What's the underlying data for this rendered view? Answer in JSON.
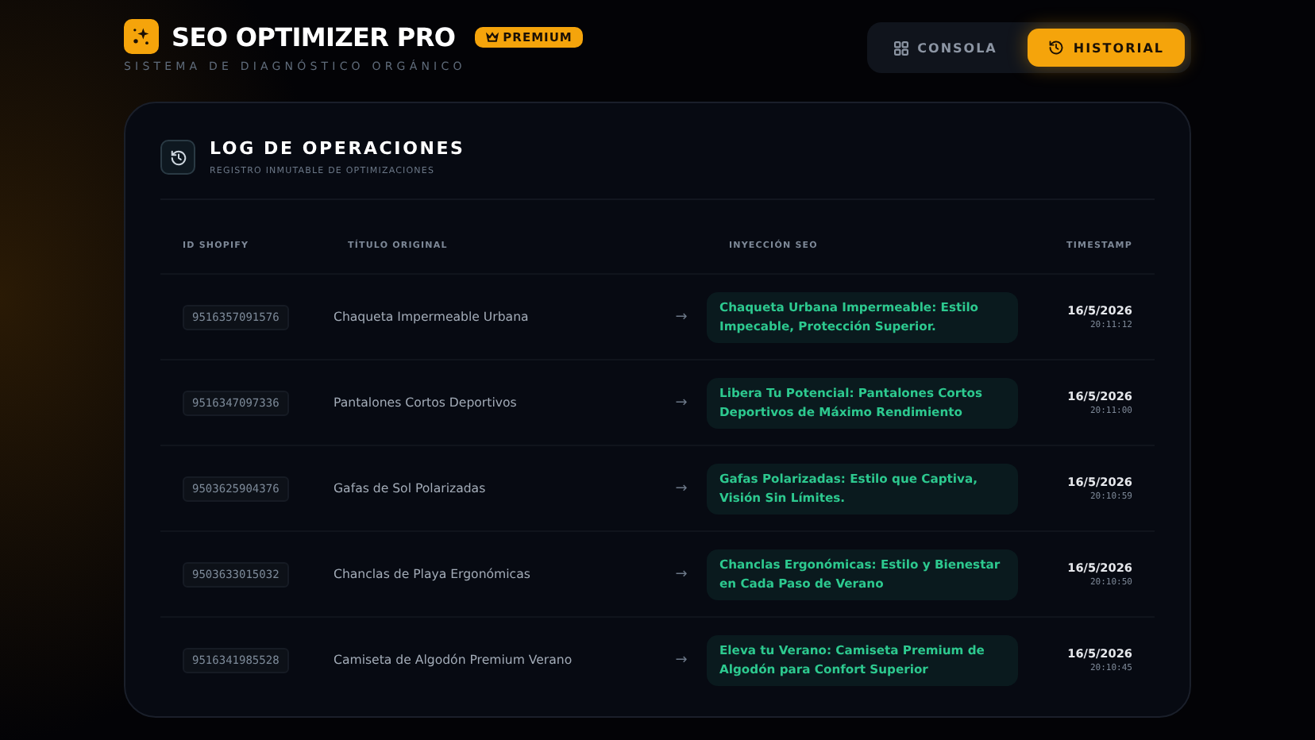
{
  "brand": {
    "name": "SEO OPTIMIZER PRO",
    "badge": "PREMIUM",
    "subtitle": "SISTEMA DE DIAGNÓSTICO ORGÁNICO"
  },
  "nav": [
    {
      "label": "CONSOLA",
      "kind": "grid",
      "selected": false
    },
    {
      "label": "HISTORIAL",
      "kind": "history",
      "selected": true
    }
  ],
  "panel": {
    "title": "LOG DE OPERACIONES",
    "subtitle": "REGISTRO INMUTABLE DE OPTIMIZACIONES"
  },
  "table": {
    "columns": [
      "ID SHOPIFY",
      "TÍTULO ORIGINAL",
      "INYECCIÓN SEO",
      "TIMESTAMP"
    ],
    "rows": [
      {
        "id": "9516357091576",
        "original": "Chaqueta Impermeable Urbana",
        "arrow": "→",
        "seo": "Chaqueta Urbana Impermeable: Estilo Impecable, Protección Superior.",
        "date": "16/5/2026",
        "time": "20:11:12"
      },
      {
        "id": "9516347097336",
        "original": "Pantalones Cortos Deportivos",
        "arrow": "→",
        "seo": "Libera Tu Potencial: Pantalones Cortos Deportivos de Máximo Rendimiento",
        "date": "16/5/2026",
        "time": "20:11:00"
      },
      {
        "id": "9503625904376",
        "original": "Gafas de Sol Polarizadas",
        "arrow": "→",
        "seo": "Gafas Polarizadas: Estilo que Captiva, Visión Sin Límites.",
        "date": "16/5/2026",
        "time": "20:10:59"
      },
      {
        "id": "9503633015032",
        "original": "Chanclas de Playa Ergonómicas",
        "arrow": "→",
        "seo": "Chanclas Ergonómicas: Estilo y Bienestar en Cada Paso de Verano",
        "date": "16/5/2026",
        "time": "20:10:50"
      },
      {
        "id": "9516341985528",
        "original": "Camiseta de Algodón Premium Verano",
        "arrow": "→",
        "seo": "Eleva tu Verano: Camiseta Premium de Algodón para Confort Superior",
        "date": "16/5/2026",
        "time": "20:10:45"
      }
    ]
  }
}
